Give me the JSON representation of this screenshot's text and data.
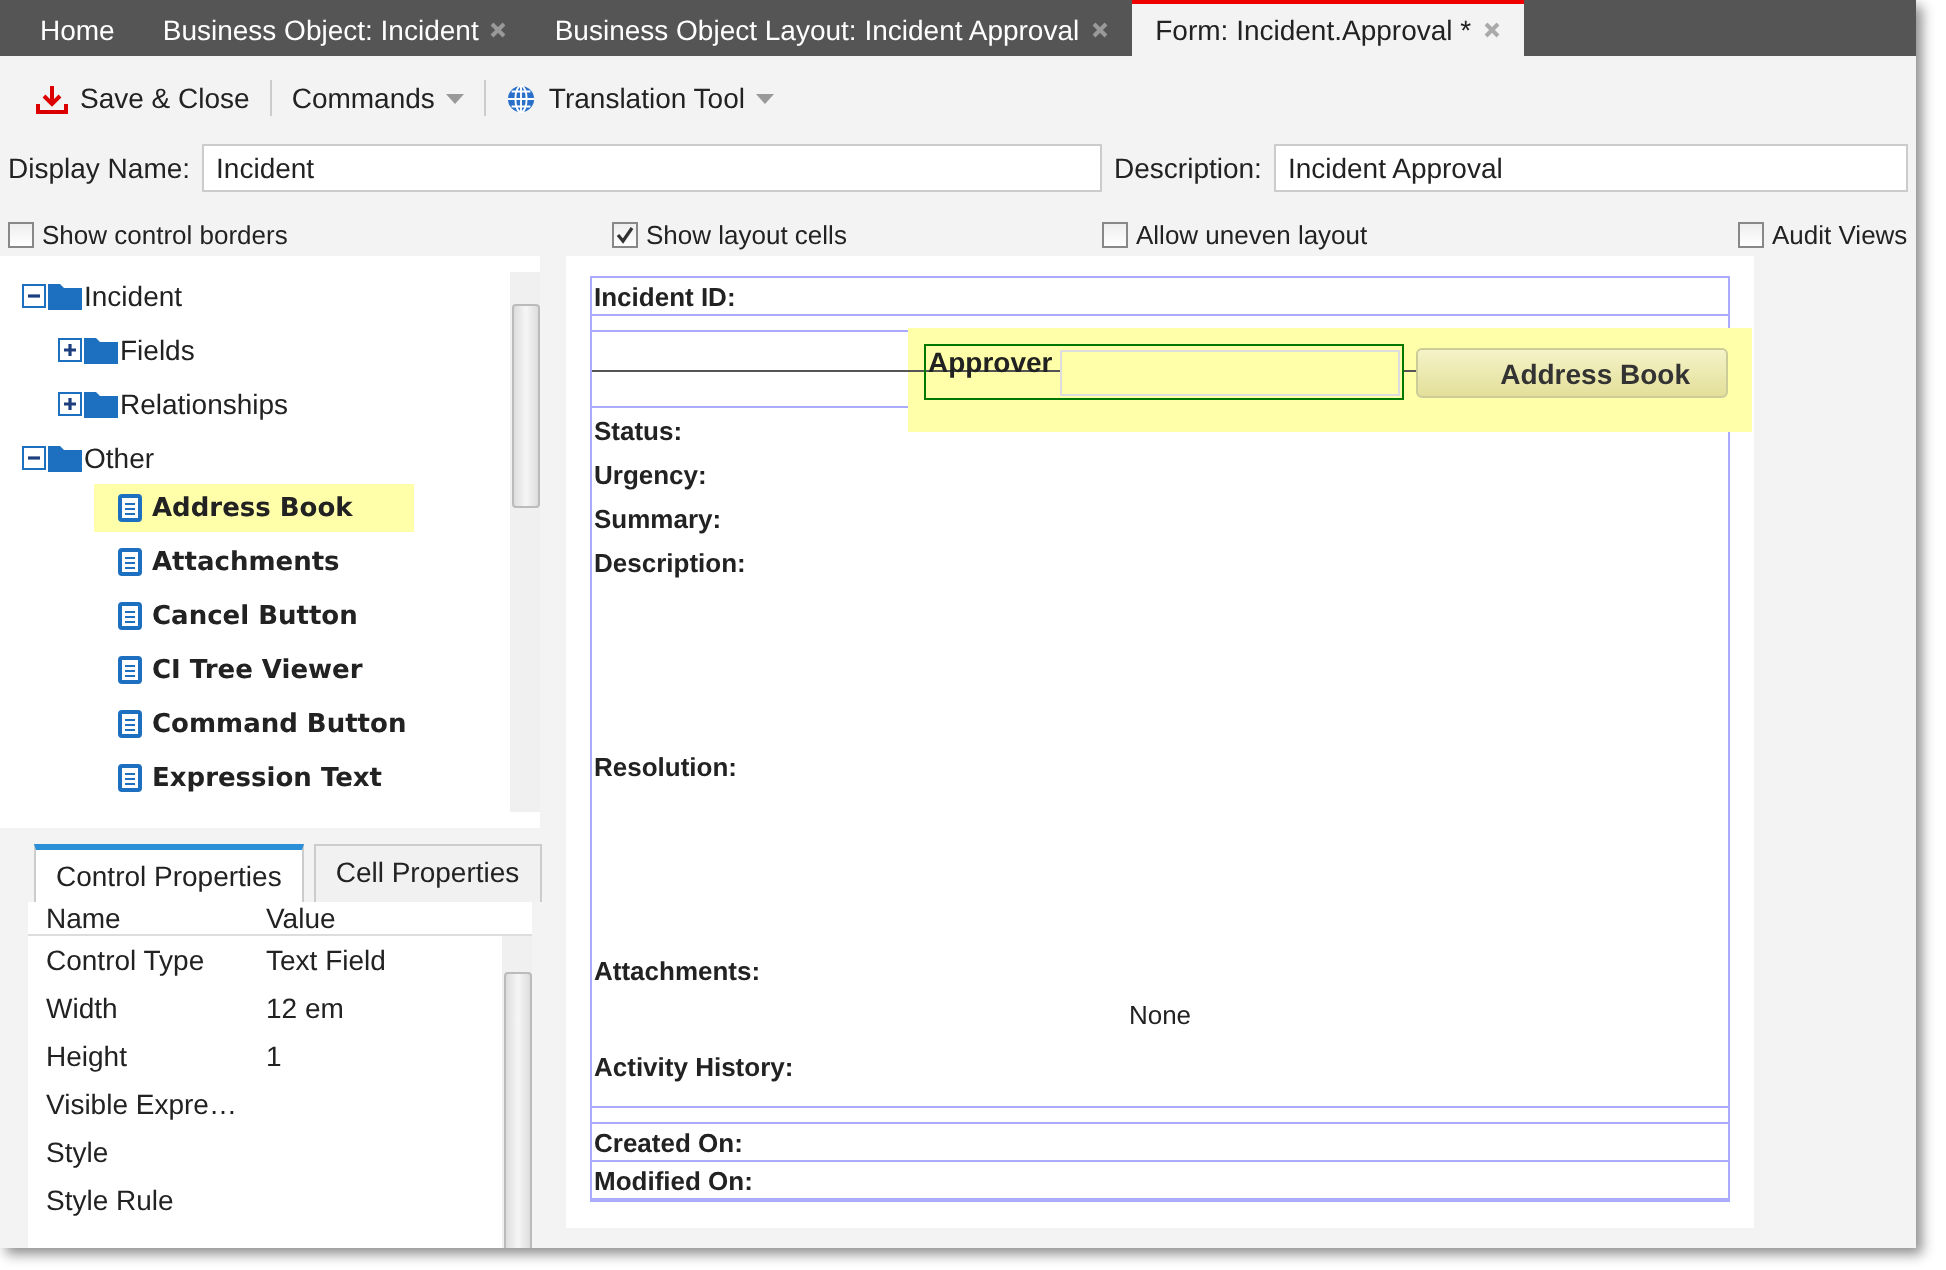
{
  "tabs": [
    {
      "label": "Home",
      "selected": false,
      "closable": false
    },
    {
      "label": "Business Object: Incident",
      "selected": false,
      "closable": true
    },
    {
      "label": "Business Object Layout: Incident Approval",
      "selected": false,
      "closable": true
    },
    {
      "label": "Form: Incident.Approval *",
      "selected": true,
      "closable": true
    }
  ],
  "toolbar": [
    {
      "kind": "save",
      "label": "Save & Close"
    },
    {
      "kind": "menu",
      "label": "Commands"
    },
    {
      "kind": "globe-menu",
      "label": "Translation Tool"
    }
  ],
  "display_name": {
    "label": "Display Name:",
    "value": "Incident"
  },
  "description": {
    "label": "Description:",
    "value": "Incident Approval"
  },
  "options": [
    {
      "label": "Show control borders",
      "checked": false
    },
    {
      "label": "Show layout cells",
      "checked": true
    },
    {
      "label": "Allow uneven layout",
      "checked": false
    },
    {
      "label": "Audit Views",
      "checked": false
    }
  ],
  "tree": [
    {
      "label": "Incident",
      "kind": "folder",
      "expanded": true,
      "children": [
        {
          "label": "Fields",
          "kind": "folder",
          "expanded": false
        },
        {
          "label": "Relationships",
          "kind": "folder",
          "expanded": false
        }
      ]
    },
    {
      "label": "Other",
      "kind": "folder",
      "expanded": true,
      "children": [
        {
          "label": "Address Book",
          "kind": "control",
          "selected": true
        },
        {
          "label": "Attachments",
          "kind": "control",
          "selected": false
        },
        {
          "label": "Cancel Button",
          "kind": "control",
          "selected": false
        },
        {
          "label": "CI Tree Viewer",
          "kind": "control",
          "selected": false
        },
        {
          "label": "Command Button",
          "kind": "control",
          "selected": false
        },
        {
          "label": "Expression Text",
          "kind": "control",
          "selected": false
        }
      ]
    }
  ],
  "property_tabs": [
    {
      "label": "Control Properties",
      "selected": true
    },
    {
      "label": "Cell Properties",
      "selected": false
    }
  ],
  "properties": {
    "columns": [
      "Name",
      "Value"
    ],
    "rows": [
      [
        "Control Type",
        "Text Field"
      ],
      [
        "Width",
        "12 em"
      ],
      [
        "Height",
        "1"
      ],
      [
        "Visible Expre…",
        ""
      ],
      [
        "Style",
        ""
      ],
      [
        "Style Rule",
        ""
      ]
    ]
  },
  "form": [
    {
      "kind": "row",
      "label": "Incident ID:"
    },
    {
      "kind": "spacer"
    },
    {
      "kind": "approver",
      "label": "Approver",
      "button": "Address Book"
    },
    {
      "kind": "group",
      "items": [
        {
          "kind": "label",
          "text": "Status:"
        },
        {
          "kind": "label",
          "text": "Urgency:"
        },
        {
          "kind": "label",
          "text": "Summary:"
        },
        {
          "kind": "area",
          "text": "Description:"
        },
        {
          "kind": "area",
          "text": "Resolution:"
        },
        {
          "kind": "label",
          "text": "Attachments:"
        },
        {
          "kind": "value",
          "text": "None"
        },
        {
          "kind": "label",
          "text": "Activity History:"
        }
      ]
    },
    {
      "kind": "spacer"
    },
    {
      "kind": "row",
      "label": "Created On:"
    },
    {
      "kind": "row",
      "label": "Modified On:"
    }
  ]
}
